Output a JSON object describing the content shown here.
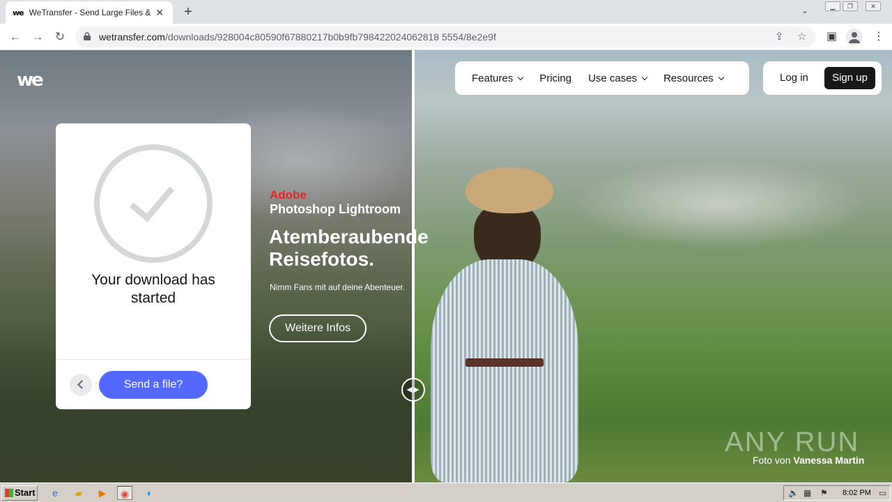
{
  "browser": {
    "tab_title": "WeTransfer - Send Large Files & Sha",
    "tab_favicon": "we",
    "url_host": "wetransfer.com",
    "url_path": "/downloads/928004c80590f67880217b0b9fb798422024062818 5554/8e2e9f"
  },
  "site": {
    "logo": "we",
    "nav": [
      "Features",
      "Pricing",
      "Use cases",
      "Resources"
    ],
    "login": "Log in",
    "signup": "Sign up"
  },
  "card": {
    "title": "Your download has started",
    "send_button": "Send a file?"
  },
  "ad": {
    "brand": "Adobe",
    "product": "Photoshop Lightroom",
    "headline": "Atemberaubende Reisefotos.",
    "subtext": "Nimm Fans mit auf deine Abenteuer.",
    "cta": "Weitere Infos"
  },
  "photo_credit": {
    "prefix": "Foto von",
    "name": "Vanessa Martin"
  },
  "watermark": "ANY RUN",
  "taskbar": {
    "start": "Start",
    "clock": "8:02 PM"
  },
  "colors": {
    "primary_button": "#5268ff",
    "adobe_red": "#e8222a",
    "signup_bg": "#17181a"
  }
}
